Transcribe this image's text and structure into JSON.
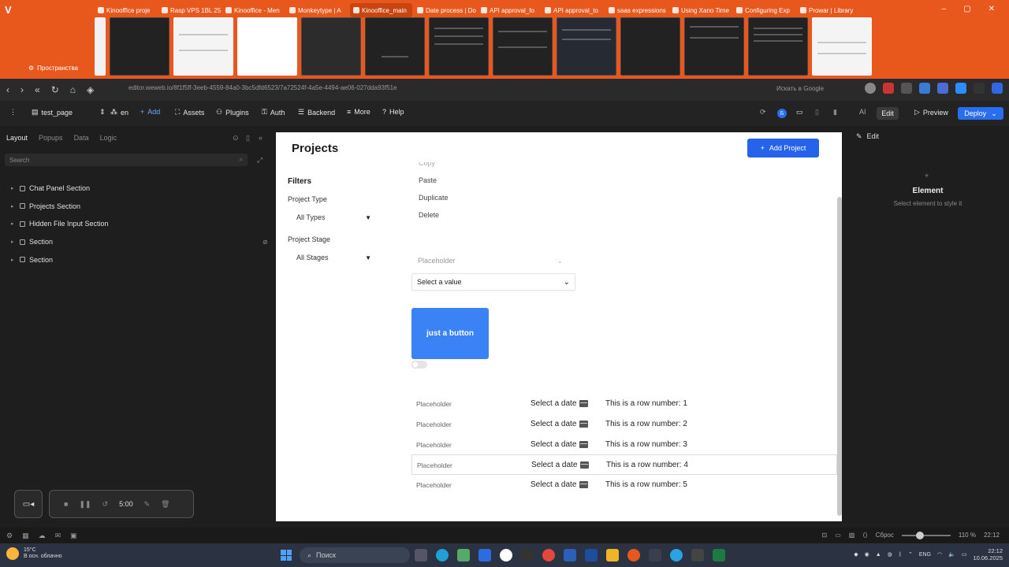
{
  "browser": {
    "tabs": [
      "KinooffIce proje",
      "Rasp VPS 1BL 250",
      "Kinooffice - Men",
      "Monkeytype | A",
      "Kinooffice_main",
      "Date process | Do",
      "API approval_fo",
      "API approval_to",
      "saas expressions",
      "Using Xano Time",
      "Configuring Exp",
      "Prowar | Library"
    ],
    "active_tab_index": 4,
    "spaces_label": "Пространства",
    "url": "editor.weweb.io/8f1f5ff-3eeb-4559-84a0-3bc5dfd6523/7a72524f-4a5e-4494-ae06-027dda93f51e",
    "search_engine_label": "Искать в Google"
  },
  "toolbar": {
    "page_name": "test_page",
    "lang": "en",
    "add_label": "Add",
    "assets_label": "Assets",
    "plugins_label": "Plugins",
    "auth_label": "Auth",
    "backend_label": "Backend",
    "more_label": "More",
    "help_label": "Help",
    "ai_label": "AI",
    "edit_label": "Edit",
    "preview_label": "Preview",
    "deploy_label": "Deploy"
  },
  "left_panel": {
    "tabs": [
      "Layout",
      "Popups",
      "Data",
      "Logic"
    ],
    "active_tab": "Layout",
    "search_placeholder": "Search",
    "tree": [
      "Chat Panel Section",
      "Projects Section",
      "Hidden File Input Section",
      "Section",
      "Section"
    ]
  },
  "page": {
    "title": "Projects",
    "add_project_label": "Add Project",
    "filters_title": "Filters",
    "project_type_label": "Project Type",
    "project_type_value": "All Types",
    "project_stage_label": "Project Stage",
    "project_stage_value": "All Stages",
    "context_menu": [
      "Copy",
      "Paste",
      "Duplicate",
      "Delete"
    ],
    "placeholder_dropdown": "Placeholder",
    "value_dropdown": "Select a value",
    "button_label": "just a button",
    "toggle_checked": false,
    "rows": [
      {
        "placeholder": "Placeholder",
        "date": "Select a date",
        "text": "This is a row number: 1"
      },
      {
        "placeholder": "Placeholder",
        "date": "Select a date",
        "text": "This is a row number: 2"
      },
      {
        "placeholder": "Placeholder",
        "date": "Select a date",
        "text": "This is a row number: 3"
      },
      {
        "placeholder": "Placeholder",
        "date": "Select a date",
        "text": "This is a row number: 4"
      },
      {
        "placeholder": "Placeholder",
        "date": "Select a date",
        "text": "This is a row number: 5"
      }
    ],
    "selected_row_index": 3
  },
  "right_panel": {
    "edit_label": "Edit",
    "title": "Element",
    "subtitle": "Select element to style it"
  },
  "recorder": {
    "time": "5:00"
  },
  "statusbar": {
    "reset_label": "Сброс",
    "zoom": "110 %",
    "time": "22:12"
  },
  "taskbar": {
    "temperature": "15°C",
    "weather_text": "В осн. облачно",
    "search_label": "Поиск",
    "lang": "ENG",
    "time": "22:12",
    "date": "10.06.2025"
  },
  "colors": {
    "browser_accent": "#e8581c",
    "primary": "#2563eb",
    "button_blue": "#3b82f6",
    "editor_bg": "#1e1e1e"
  }
}
